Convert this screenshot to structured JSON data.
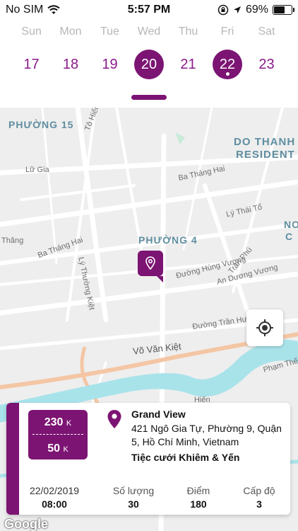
{
  "status_bar": {
    "carrier": "No SIM",
    "time": "5:57 PM",
    "battery": "69%",
    "battery_level": 0.69
  },
  "calendar": {
    "days": [
      {
        "name": "Sun",
        "date": "17",
        "selected": false,
        "has_event": false
      },
      {
        "name": "Mon",
        "date": "18",
        "selected": false,
        "has_event": false
      },
      {
        "name": "Tue",
        "date": "19",
        "selected": false,
        "has_event": false
      },
      {
        "name": "Wed",
        "date": "20",
        "selected": true,
        "has_event": false
      },
      {
        "name": "Thu",
        "date": "21",
        "selected": false,
        "has_event": false
      },
      {
        "name": "Fri",
        "date": "22",
        "selected": true,
        "has_event": true
      },
      {
        "name": "Sat",
        "date": "23",
        "selected": false,
        "has_event": false
      }
    ]
  },
  "map": {
    "districts": [
      "PHƯỜNG 15",
      "DO THANH",
      "RESIDENT",
      "PHƯỜNG 4",
      "NO",
      "C"
    ],
    "streets": [
      "Tô Hiến Thành",
      "Lữ Gia",
      "Ba Tháng Hai",
      "Lý Thái Tổ",
      "Ba Tháng Hai",
      "Thăng",
      "Lý Thường Kiệt",
      "Đường Hùng Vương",
      "Trần Phú",
      "An Dương Vương",
      "Đường Trần Hưng Đạo",
      "Võ Văn Kiệt",
      "Phạm Thế H",
      "Hiến"
    ],
    "attribution": "Google"
  },
  "event_card": {
    "price_high": "230",
    "price_low": "50",
    "price_unit": "K",
    "venue_name": "Grand View",
    "venue_address": "421 Ngô Gia Tự, Phường 9, Quận 5, Hồ Chí Minh, Vietnam",
    "event_title": "Tiệc cưới Khiêm & Yến",
    "date": "22/02/2019",
    "time": "08:00",
    "quantity_label": "Số lượng",
    "quantity_value": "30",
    "points_label": "Điểm",
    "points_value": "180",
    "level_label": "Cấp độ",
    "level_value": "3"
  },
  "colors": {
    "accent": "#7c1473",
    "date_text": "#8a1a8a",
    "map_bg": "#eeeeee",
    "river": "#a9e3ea"
  }
}
